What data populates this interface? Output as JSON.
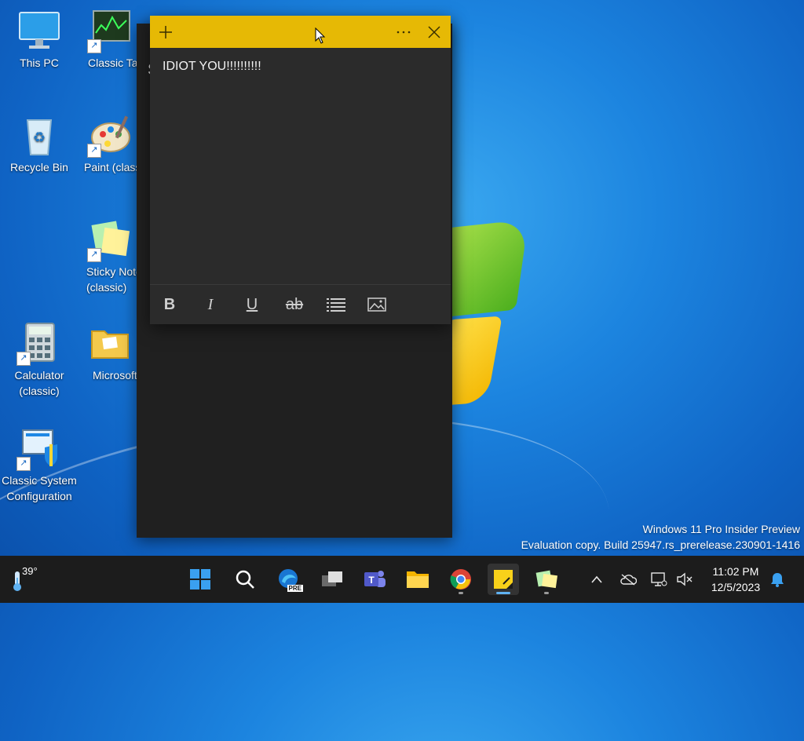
{
  "desktop": {
    "icons": [
      {
        "label": "This PC"
      },
      {
        "label": "Classic Task Manager"
      },
      {
        "label": "Recycle Bin"
      },
      {
        "label": "Paint (classic)"
      },
      {
        "label": "Sticky Notes (classic)"
      },
      {
        "label": "Calculator (classic)"
      },
      {
        "label": "Microsoft Games"
      },
      {
        "label": "Classic System Configuration"
      }
    ],
    "watermark": {
      "line1": "Windows 11 Pro Insider Preview",
      "line2": "Evaluation copy. Build 25947.rs_prerelease.230901-1416"
    }
  },
  "back_window": {
    "title_fragment": "S"
  },
  "sticky_note": {
    "accent_color": "#e6b905",
    "body_text": "IDIOT YOU!!!!!!!!!!",
    "titlebar": {
      "add_icon": "plus-icon",
      "menu_icon": "more-horizontal-icon",
      "close_icon": "close-icon"
    },
    "toolbar": {
      "bold": "B",
      "italic": "I",
      "underline": "U",
      "strikethrough": "ab"
    }
  },
  "taskbar": {
    "weather_temp": "39°",
    "clock_time": "11:02 PM",
    "clock_date": "12/5/2023",
    "apps": [
      {
        "icon": "windows-start-icon"
      },
      {
        "icon": "search-icon"
      },
      {
        "icon": "edge-preview-icon",
        "badge": "PRE"
      },
      {
        "icon": "task-view-icon"
      },
      {
        "icon": "teams-icon"
      },
      {
        "icon": "file-explorer-icon"
      },
      {
        "icon": "chrome-icon"
      },
      {
        "icon": "sticky-notes-icon"
      },
      {
        "icon": "sticky-notes-classic-icon"
      }
    ]
  }
}
